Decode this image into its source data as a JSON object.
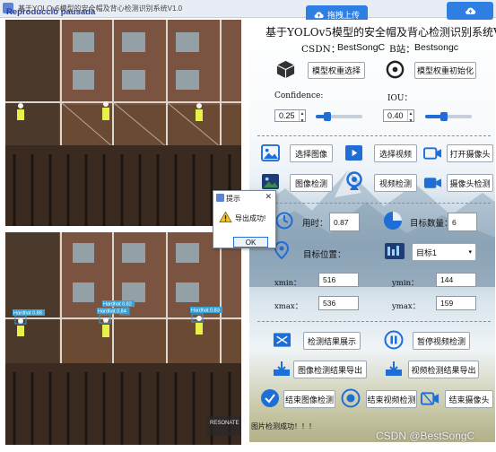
{
  "window": {
    "title": "基于YOLOv5模型的安全帽及背心检测识别系统V1.0",
    "overlay_text": "Reproducció pausada"
  },
  "drag_upload": "拖拽上传",
  "header": {
    "title": "基于YOLOv5模型的安全帽及背心检测识别系统V1.0",
    "csdn_label": "CSDN：",
    "csdn_value": "BestSongC",
    "bili_label": "B站：",
    "bili_value": "Bestsongc"
  },
  "model": {
    "select_button": "模型权重选择",
    "init_button": "模型权重初始化"
  },
  "params": {
    "confidence_label": "Confidence:",
    "confidence_value": "0.25",
    "confidence_level": 0.25,
    "iou_label": "IOU：",
    "iou_value": "0.40",
    "iou_level": 0.4
  },
  "actions": {
    "select_image": "选择图像",
    "select_video": "选择视频",
    "open_camera": "打开摄像头",
    "image_detect": "图像检测",
    "video_detect": "视频检测",
    "camera_detect": "摄像头检测"
  },
  "results": {
    "time_label": "用时：",
    "time_value": "0.87",
    "count_label": "目标数量：",
    "count_value": "6",
    "pos_label": "目标位置：",
    "target_select": "目标1",
    "xmin_label": "xmin：",
    "xmin_value": "516",
    "ymin_label": "ymin：",
    "ymin_value": "144",
    "xmax_label": "xmax：",
    "xmax_value": "536",
    "ymax_label": "ymax：",
    "ymax_value": "159"
  },
  "bottom": {
    "show_results": "检测结果展示",
    "pause_video": "暂停视频检测",
    "export_image": "图像检测结果导出",
    "export_video": "视频检测结果导出",
    "end_image": "结束图像检测",
    "end_video": "结束视频检测",
    "end_camera": "结束摄像头"
  },
  "dialog": {
    "title": "提示",
    "close": "✕",
    "message": "导出成功!",
    "ok": "OK"
  },
  "status": "图片检测成功！！！",
  "video": {
    "labels": [
      "Hardhat 0.88",
      "Hardhat 0.84",
      "Hardhat 0.83",
      "Hardhat 0.82"
    ],
    "resonate_text": "RESONATE\nSUSTAINABLE"
  },
  "watermark": "CSDN @BestSongC",
  "colors": {
    "accent": "#1f6ed6",
    "detect_box": "#38a3d8",
    "dark_icon": "#1e3c72"
  }
}
